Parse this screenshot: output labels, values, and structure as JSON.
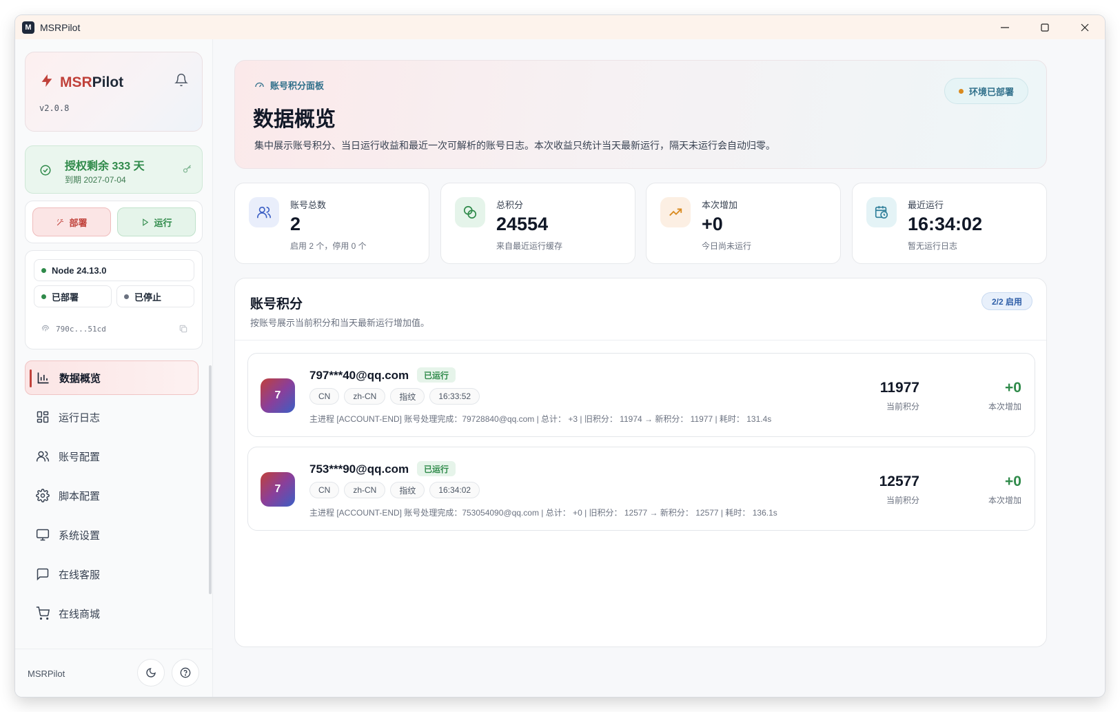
{
  "window": {
    "title": "MSRPilot",
    "logo_letter": "M"
  },
  "sidebar": {
    "brand_a": "MSR",
    "brand_b": "Pilot",
    "version": "v2.0.8",
    "license_main": "授权剩余 333 天",
    "license_sub": "到期 2027-07-04",
    "deploy_label": "部署",
    "run_label": "运行",
    "node_label": "Node 24.13.0",
    "deployed_label": "已部署",
    "stopped_label": "已停止",
    "hash": "790c...51cd",
    "nav": [
      {
        "label": "数据概览",
        "icon": "bar-chart-icon",
        "active": true
      },
      {
        "label": "运行日志",
        "icon": "dashboard-icon",
        "active": false
      },
      {
        "label": "账号配置",
        "icon": "users-icon",
        "active": false
      },
      {
        "label": "脚本配置",
        "icon": "gear-icon",
        "active": false
      },
      {
        "label": "系统设置",
        "icon": "monitor-icon",
        "active": false
      },
      {
        "label": "在线客服",
        "icon": "chat-icon",
        "active": false
      },
      {
        "label": "在线商城",
        "icon": "cart-icon",
        "active": false
      }
    ],
    "footer_name": "MSRPilot"
  },
  "hero": {
    "tag": "账号积分面板",
    "title": "数据概览",
    "desc": "集中展示账号积分、当日运行收益和最近一次可解析的账号日志。本次收益只统计当天最新运行，隔天未运行会自动归零。",
    "env_status": "环境已部署"
  },
  "stats": [
    {
      "label": "账号总数",
      "value": "2",
      "sub": "启用 2 个，停用 0 个",
      "icon": "users-icon"
    },
    {
      "label": "总积分",
      "value": "24554",
      "sub": "来自最近运行缓存",
      "icon": "coins-icon"
    },
    {
      "label": "本次增加",
      "value": "+0",
      "sub": "今日尚未运行",
      "icon": "trending-up-icon"
    },
    {
      "label": "最近运行",
      "value": "16:34:02",
      "sub": "暂无运行日志",
      "icon": "calendar-clock-icon"
    }
  ],
  "panel": {
    "title": "账号积分",
    "desc": "按账号展示当前积分和当天最新运行增加值。",
    "enabled": "2/2 启用",
    "accounts": [
      {
        "avatar": "7",
        "email": "797***40@qq.com",
        "status": "已运行",
        "chips": [
          "CN",
          "zh-CN",
          "指纹",
          "16:33:52"
        ],
        "log": "主进程 [ACCOUNT-END] 账号处理完成：79728840@qq.com | 总计： +3 | 旧积分： 11974 → 新积分： 11977 | 耗时： 131.4s",
        "points": "11977",
        "points_label": "当前积分",
        "inc": "+0",
        "inc_label": "本次增加"
      },
      {
        "avatar": "7",
        "email": "753***90@qq.com",
        "status": "已运行",
        "chips": [
          "CN",
          "zh-CN",
          "指纹",
          "16:34:02"
        ],
        "log": "主进程 [ACCOUNT-END] 账号处理完成：753054090@qq.com | 总计： +0 | 旧积分： 12577 → 新积分： 12577 | 耗时： 136.1s",
        "points": "12577",
        "points_label": "当前积分",
        "inc": "+0",
        "inc_label": "本次增加"
      }
    ]
  },
  "colors": {
    "accent": "#c0413a",
    "success": "#2f8a4a",
    "teal": "#2f6f8a",
    "env_dot": "#d98a1f"
  }
}
